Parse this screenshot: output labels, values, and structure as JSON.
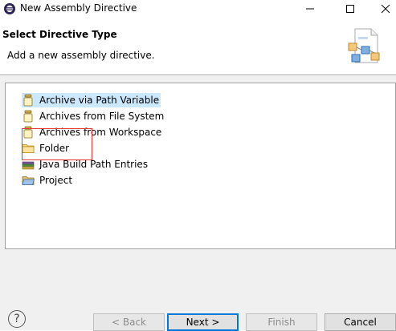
{
  "window": {
    "title": "New Assembly Directive",
    "minimize_symbol": "—",
    "close_symbol": "✕"
  },
  "header": {
    "title": "Select Directive Type",
    "message": "Add a new assembly directive."
  },
  "tree": {
    "items": [
      {
        "label": "Archive via Path Variable",
        "icon": "jar-icon",
        "selected": true
      },
      {
        "label": "Archives from File System",
        "icon": "jar-icon",
        "selected": false
      },
      {
        "label": "Archives from Workspace",
        "icon": "jar-icon",
        "selected": false
      },
      {
        "label": "Folder",
        "icon": "folder-icon",
        "selected": false
      },
      {
        "label": "Java Build Path Entries",
        "icon": "library-icon",
        "selected": false
      },
      {
        "label": "Project",
        "icon": "project-folder-icon",
        "selected": false
      }
    ]
  },
  "buttons": {
    "help": "?",
    "back": "< Back",
    "next": "Next >",
    "finish": "Finish",
    "cancel": "Cancel"
  },
  "colors": {
    "selection": "#cce8ff",
    "highlight_box": "#e53935",
    "default_button_border": "#0078d7"
  }
}
